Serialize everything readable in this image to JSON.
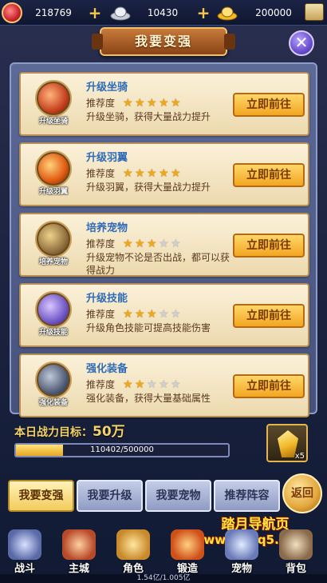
{
  "resources": [
    {
      "value": "218769",
      "icon": "red-gem-icon"
    },
    {
      "value": "10430",
      "icon": "silver-ingot-icon"
    },
    {
      "value": "200000",
      "icon": "gold-ingot-icon"
    }
  ],
  "title": "我要变强",
  "tasks": [
    {
      "name": "升级坐骑",
      "caption": "升级坐骑",
      "rec_label": "推荐度",
      "stars": 5,
      "desc": "升级坐骑，获得大量战力提升",
      "button": "立即前往",
      "icon": "mount-icon"
    },
    {
      "name": "升级羽翼",
      "caption": "升级羽翼",
      "rec_label": "推荐度",
      "stars": 5,
      "desc": "升级羽翼，获得大量战力提升",
      "button": "立即前往",
      "icon": "wings-icon"
    },
    {
      "name": "培养宠物",
      "caption": "培养宠物",
      "rec_label": "推荐度",
      "stars": 3,
      "desc": "升级宠物不论是否出战，都可以获得战力",
      "button": "立即前往",
      "icon": "pet-icon"
    },
    {
      "name": "升级技能",
      "caption": "升级技能",
      "rec_label": "推荐度",
      "stars": 3,
      "desc": "升级角色技能可提高技能伤害",
      "button": "立即前往",
      "icon": "skill-book-icon"
    },
    {
      "name": "强化装备",
      "caption": "强化装备",
      "rec_label": "推荐度",
      "stars": 2,
      "desc": "强化装备，获得大量基础属性",
      "button": "立即前往",
      "icon": "equipment-icon"
    }
  ],
  "power": {
    "label": "本日战力目标：",
    "value": "50万",
    "progress_text": "110402/500000",
    "progress_fraction": 0.2208
  },
  "reward": {
    "count": "x5"
  },
  "tabs": [
    "我要变强",
    "我要升级",
    "我要宠物",
    "推荐阵容"
  ],
  "back_label": "返回",
  "watermark": {
    "title": "踏月导航页",
    "url": "www.q1q5.com"
  },
  "nav": [
    "战斗",
    "主城",
    "角色",
    "锻造",
    "宠物",
    "背包"
  ],
  "exp_text": "1.54亿/1.005亿",
  "colors": {
    "accent": "#f2a521",
    "panel": "#5c6a98",
    "title_blue": "#2f6bb7"
  }
}
